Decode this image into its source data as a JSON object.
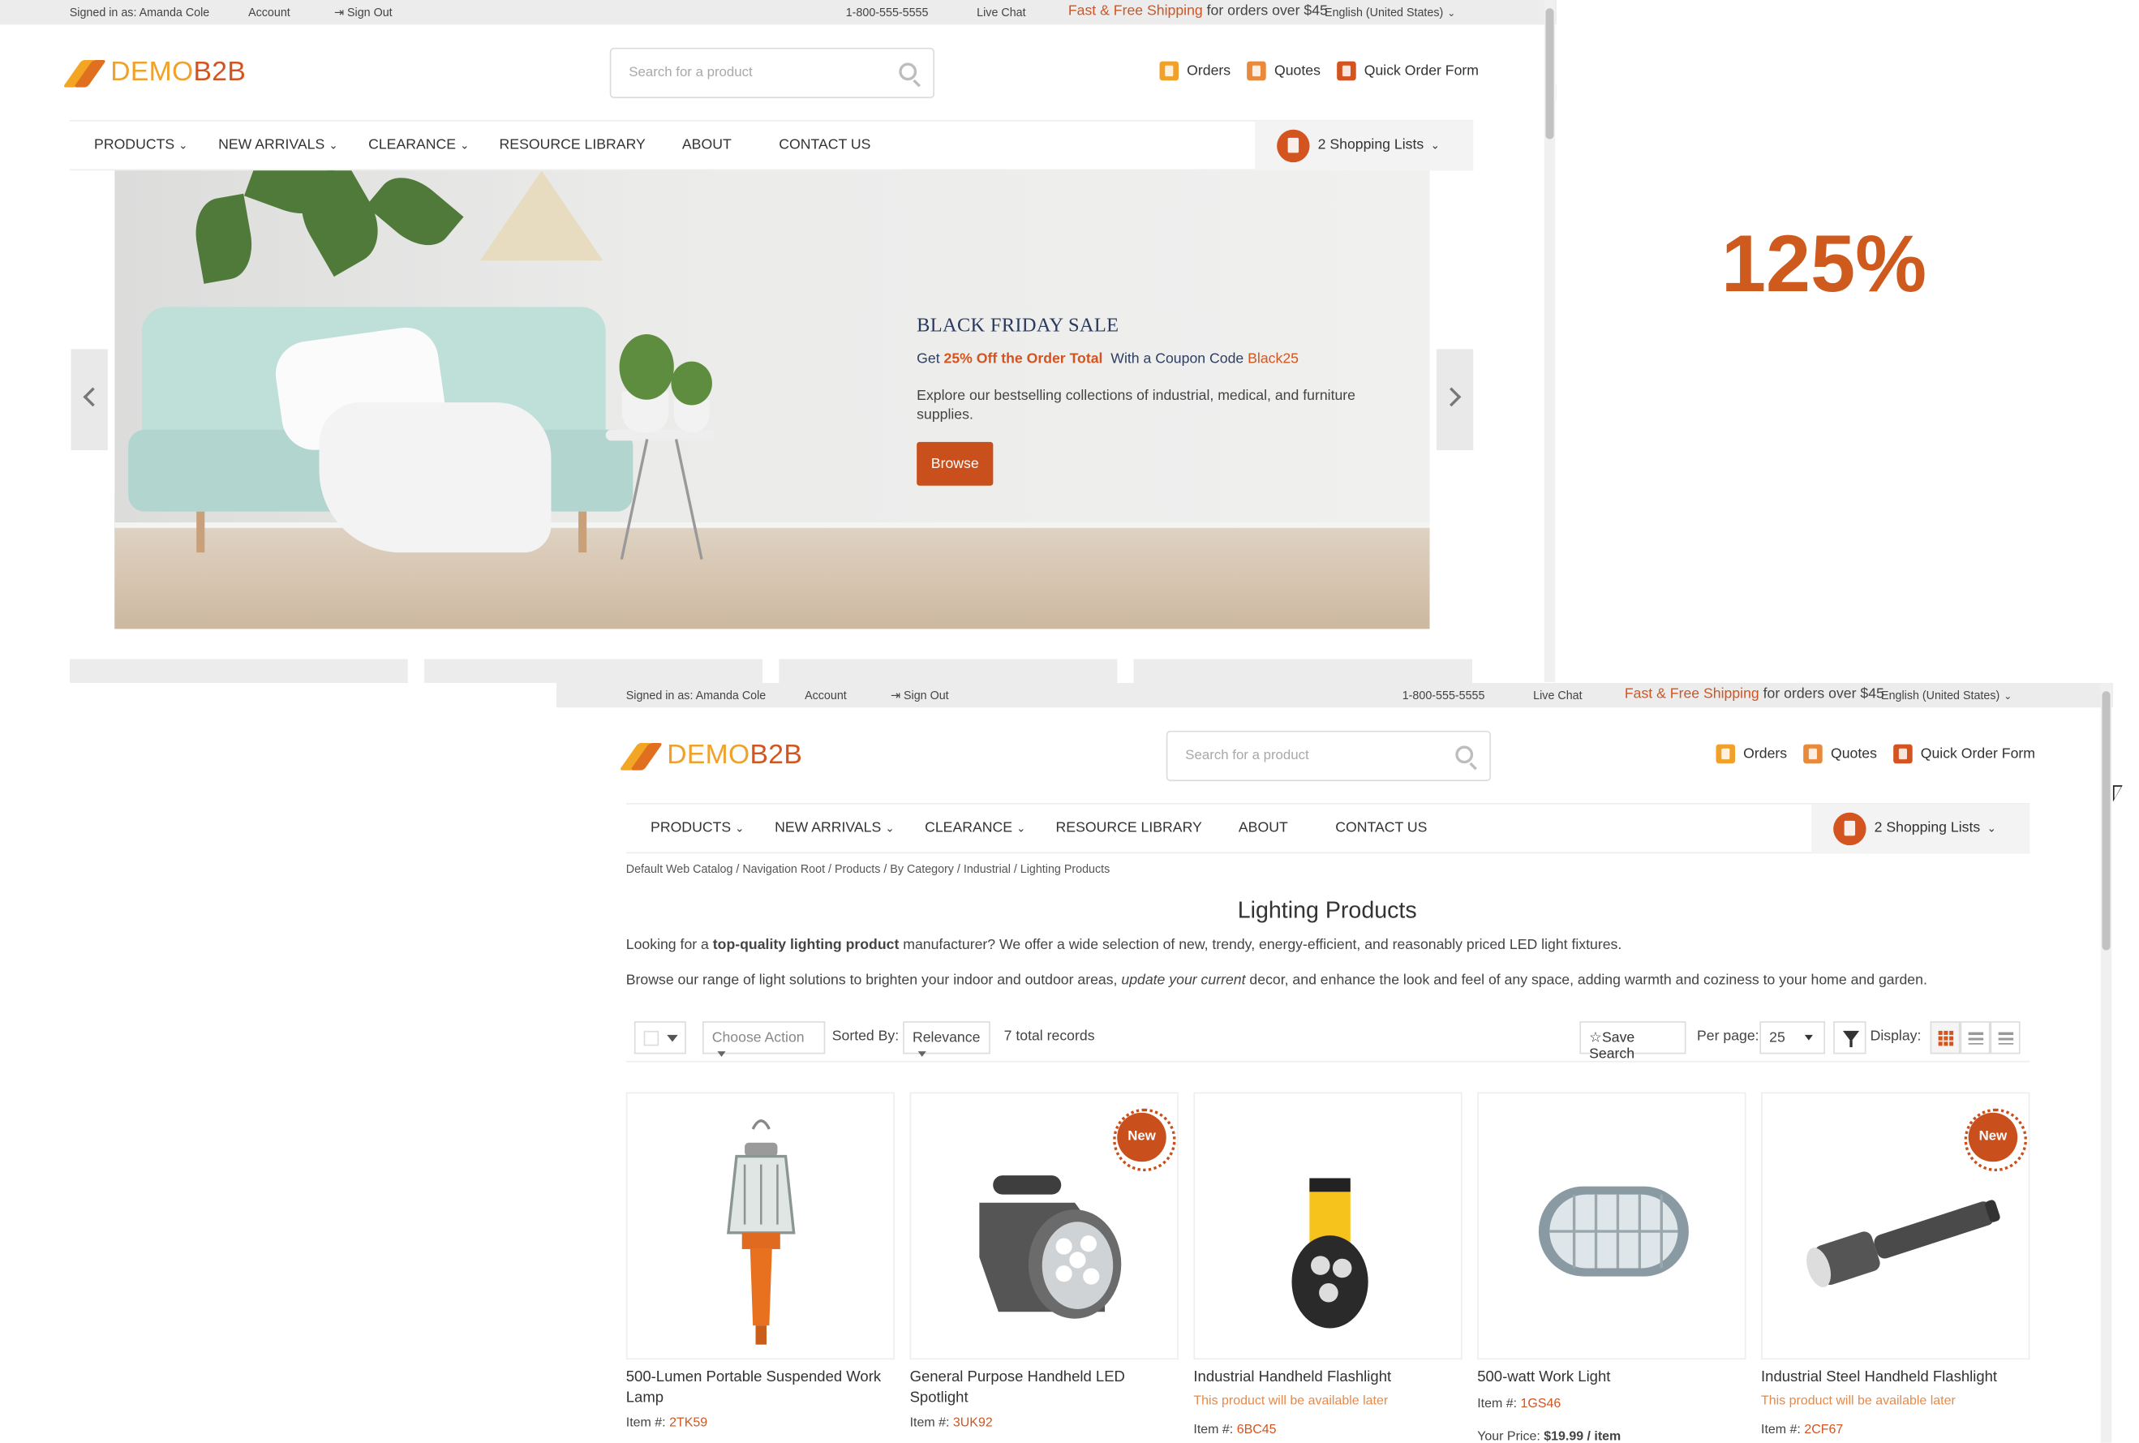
{
  "zoom_label": "125%",
  "topbar": {
    "signed_in": "Signed in as: Amanda Cole",
    "account": "Account",
    "sign_out": "Sign Out",
    "phone": "1-800-555-5555",
    "live_chat": "Live Chat",
    "ship_highlight": "Fast & Free Shipping",
    "ship_rest": " for orders over $45",
    "language": "English (United States)"
  },
  "header": {
    "logo_demo": "DEMO",
    "logo_b2b": "B2B",
    "search_placeholder": "Search for a product",
    "orders": "Orders",
    "quotes": "Quotes",
    "quick_order": "Quick Order Form"
  },
  "nav": {
    "products": "PRODUCTS",
    "new_arrivals": "NEW ARRIVALS",
    "clearance": "CLEARANCE",
    "resource_library": "RESOURCE LIBRARY",
    "about": "ABOUT",
    "contact_us": "CONTACT US",
    "shopping_lists": "2 Shopping Lists"
  },
  "hero": {
    "title": "BLACK FRIDAY SALE",
    "sub_prefix": "Get ",
    "sub_highlight": "25% Off the Order Total",
    "sub_mid": "  With a Coupon Code ",
    "coupon": "Black25",
    "description": "Explore our bestselling collections of industrial, medical, and furniture supplies.",
    "button": "Browse"
  },
  "listing": {
    "breadcrumb": "Default Web Catalog / Navigation Root / Products / By Category / Industrial / Lighting Products",
    "title": "Lighting Products",
    "intro1_a": "Looking for a ",
    "intro1_b": "top-quality lighting product",
    "intro1_c": " manufacturer? We offer a wide selection of new, trendy, energy-efficient, and reasonably priced LED light fixtures.",
    "intro2_a": "Browse our range of light solutions to brighten your indoor and outdoor areas, ",
    "intro2_b": "update your current",
    "intro2_c": " decor, and enhance the look and feel of any space, adding warmth and coziness to your home and garden.",
    "choose_action": "Choose Action",
    "sorted_by": "Sorted By:",
    "sort_value": "Relevance",
    "total_records": "7 total records",
    "save_search": "Save Search",
    "per_page_label": "Per page:",
    "per_page_value": "25",
    "display_label": "Display:"
  },
  "products": [
    {
      "name": "500-Lumen Portable Suspended Work Lamp",
      "item_label": "Item #: ",
      "code": "2TK59",
      "badge": "",
      "availability": ""
    },
    {
      "name": "General Purpose Handheld LED Spotlight",
      "item_label": "Item #: ",
      "code": "3UK92",
      "badge": "New",
      "availability": ""
    },
    {
      "name": "Industrial Handheld Flashlight",
      "item_label": "Item #: ",
      "code": "6BC45",
      "badge": "",
      "availability": "This product will be available later"
    },
    {
      "name": "500-watt Work Light",
      "item_label": "Item #: ",
      "code": "1GS46",
      "badge": "",
      "availability": "",
      "price_label": "Your Price:",
      "price": "$19.99 / item"
    },
    {
      "name": "Industrial Steel Handheld Flashlight",
      "item_label": "Item #: ",
      "code": "2CF67",
      "badge": "New",
      "availability": "This product will be available later"
    }
  ],
  "colors": {
    "accent": "#d3541f",
    "accent_light": "#f0a12a",
    "button": "#c94f1c"
  },
  "icons": [
    "search-icon",
    "sign-out-icon",
    "orders-icon",
    "quotes-icon",
    "quick-order-icon",
    "shopping-list-icon",
    "chevron-left-icon",
    "chevron-right-icon",
    "star-icon",
    "filter-icon",
    "grid-view-icon",
    "list-view-icon",
    "compact-view-icon",
    "cursor-icon"
  ]
}
